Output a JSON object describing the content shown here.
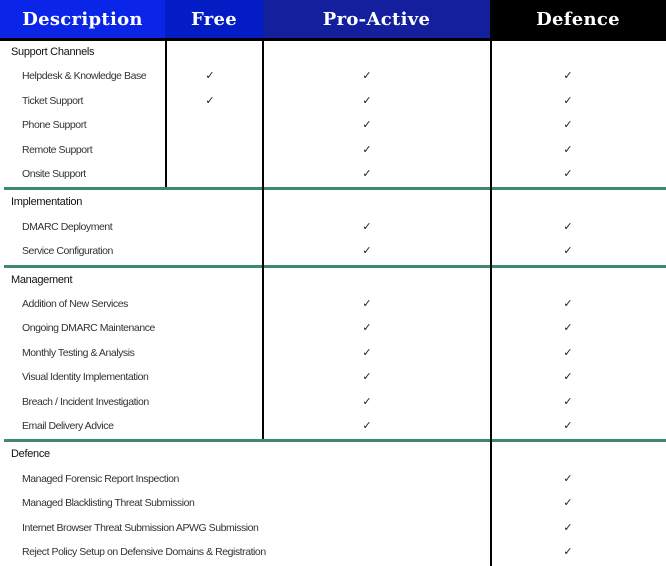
{
  "header": {
    "columns": [
      {
        "label": "Description",
        "bg": "#0a24e8"
      },
      {
        "label": "Free",
        "bg": "#041cc4"
      },
      {
        "label": "Pro-Active",
        "bg": "#141f9e"
      },
      {
        "label": "Defence",
        "bg": "#000000"
      }
    ]
  },
  "check_icon": "✓",
  "divider_color": "#3d8a6b",
  "sections": [
    {
      "title": "Support Channels",
      "items": [
        {
          "label": "Helpdesk & Knowledge Base",
          "free": true,
          "proactive": true,
          "defence": true
        },
        {
          "label": "Ticket Support",
          "free": true,
          "proactive": true,
          "defence": true
        },
        {
          "label": "Phone Support",
          "free": false,
          "proactive": true,
          "defence": true
        },
        {
          "label": "Remote Support",
          "free": false,
          "proactive": true,
          "defence": true
        },
        {
          "label": "Onsite Support",
          "free": false,
          "proactive": true,
          "defence": true
        }
      ]
    },
    {
      "title": "Implementation",
      "items": [
        {
          "label": "DMARC Deployment",
          "free": false,
          "proactive": true,
          "defence": true
        },
        {
          "label": "Service Configuration",
          "free": false,
          "proactive": true,
          "defence": true
        }
      ]
    },
    {
      "title": "Management",
      "items": [
        {
          "label": "Addition of New Services",
          "free": false,
          "proactive": true,
          "defence": true
        },
        {
          "label": "Ongoing DMARC Maintenance",
          "free": false,
          "proactive": true,
          "defence": true
        },
        {
          "label": "Monthly Testing & Analysis",
          "free": false,
          "proactive": true,
          "defence": true
        },
        {
          "label": "Visual Identity Implementation",
          "free": false,
          "proactive": true,
          "defence": true
        },
        {
          "label": "Breach / Incident Investigation",
          "free": false,
          "proactive": true,
          "defence": true
        },
        {
          "label": "Email Delivery Advice",
          "free": false,
          "proactive": true,
          "defence": true
        }
      ]
    },
    {
      "title": "Defence",
      "items": [
        {
          "label": "Managed Forensic Report Inspection",
          "free": false,
          "proactive": false,
          "defence": true
        },
        {
          "label": "Managed Blacklisting Threat Submission",
          "free": false,
          "proactive": false,
          "defence": true
        },
        {
          "label": "Internet Browser Threat Submission APWG Submission",
          "free": false,
          "proactive": false,
          "defence": true
        },
        {
          "label": "Reject Policy Setup on Defensive Domains & Registration",
          "free": false,
          "proactive": false,
          "defence": true
        }
      ]
    }
  ]
}
